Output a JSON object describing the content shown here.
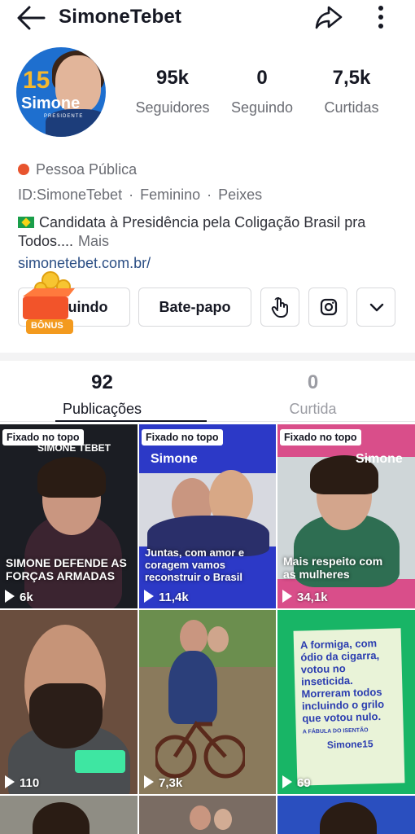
{
  "header": {
    "title": "SimoneTebet"
  },
  "avatar": {
    "number": "15",
    "name": "Simone",
    "subtitle": "PRESIDENTE"
  },
  "stats": [
    {
      "value": "95k",
      "label": "Seguidores"
    },
    {
      "value": "0",
      "label": "Seguindo"
    },
    {
      "value": "7,5k",
      "label": "Curtidas"
    }
  ],
  "profile": {
    "category": "Pessoa Pública",
    "id": "ID:SimoneTebet",
    "gender": "Feminino",
    "sign": "Peixes",
    "bio": "Candidata à Presidência pela Coligação Brasil pra Todos....",
    "bio_more": "Mais",
    "link": "simonetebet.com.br/"
  },
  "actions": {
    "follow_label": "Seguindo",
    "follow_visible": "uindo",
    "chat_label": "Bate-papo",
    "bonus_label": "BÔNUS"
  },
  "tabs": [
    {
      "count": "92",
      "label": "Publicações",
      "active": true
    },
    {
      "count": "0",
      "label": "Curtida",
      "active": false
    }
  ],
  "posts": [
    {
      "pinned": "Fixado no topo",
      "views": "6k",
      "brand": "SIMONE TEBET",
      "caption": "SIMONE DEFENDE AS FORÇAS ARMADAS"
    },
    {
      "pinned": "Fixado no topo",
      "views": "11,4k",
      "brand": "Simone",
      "caption": "Juntas, com amor e coragem vamos reconstruir o Brasil"
    },
    {
      "pinned": "Fixado no topo",
      "views": "34,1k",
      "brand": "Simone",
      "caption": "Mais respeito com as mulheres"
    },
    {
      "pinned": "",
      "views": "110",
      "brand": "",
      "caption": ""
    },
    {
      "pinned": "",
      "views": "7,3k",
      "brand": "",
      "caption": ""
    },
    {
      "pinned": "",
      "views": "69",
      "brand": "Simone15",
      "caption": "A formiga, com ódio da cigarra, votou no inseticida. Morreram todos incluindo o grilo que votou nulo.",
      "caption2": "A FÁBULA DO ISENTÃO"
    },
    {
      "pinned": "",
      "views": "",
      "brand": "",
      "caption": ""
    },
    {
      "pinned": "",
      "views": "",
      "brand": "",
      "caption": ""
    },
    {
      "pinned": "",
      "views": "",
      "brand": "",
      "caption": ""
    }
  ],
  "colors": {
    "link": "#2b4e84",
    "muted": "#6b6d74",
    "badge": "#e8542e"
  }
}
